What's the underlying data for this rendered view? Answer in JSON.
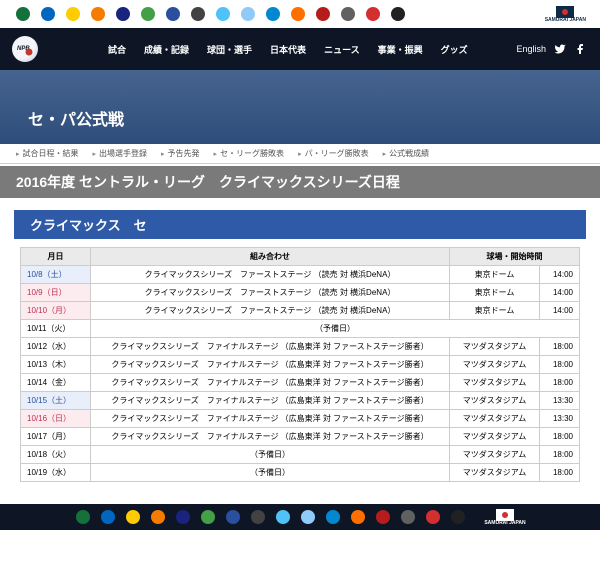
{
  "header": {
    "english_label": "English",
    "nav": [
      "試合",
      "成績・記録",
      "球団・選手",
      "日本代表",
      "ニュース",
      "事業・振興",
      "グッズ"
    ]
  },
  "team_logos": [
    {
      "bg": "#14713a",
      "name": "team-1"
    },
    {
      "bg": "#0066bf",
      "name": "team-2"
    },
    {
      "bg": "#fecc00",
      "name": "team-3"
    },
    {
      "bg": "#f57c00",
      "name": "team-4"
    },
    {
      "bg": "#1a237e",
      "name": "team-5"
    },
    {
      "bg": "#43a047",
      "name": "team-6"
    },
    {
      "bg": "#2a4f9e",
      "name": "team-7"
    },
    {
      "bg": "#424242",
      "name": "team-8"
    },
    {
      "bg": "#4fc3f7",
      "name": "team-9"
    },
    {
      "bg": "#90caf9",
      "name": "team-10"
    },
    {
      "bg": "#0288d1",
      "name": "team-11"
    },
    {
      "bg": "#ff6f00",
      "name": "team-12"
    },
    {
      "bg": "#b71c1c",
      "name": "team-13"
    },
    {
      "bg": "#616161",
      "name": "team-14"
    },
    {
      "bg": "#d32f2f",
      "name": "team-15"
    },
    {
      "bg": "#212121",
      "name": "team-16"
    }
  ],
  "samurai_label": "SAMURAI\nJAPAN",
  "hero_title": "セ・パ公式戦",
  "sub_nav": [
    "試合日程・結果",
    "出場選手登録",
    "予告先発",
    "セ・リーグ勝敗表",
    "パ・リーグ勝敗表",
    "公式戦成績"
  ],
  "title_bar": "2016年度 セントラル・リーグ　クライマックスシリーズ日程",
  "section_bar": "クライマックス　セ",
  "table": {
    "headers": {
      "date": "月日",
      "match": "組み合わせ",
      "venue_time": "球場・開始時間"
    },
    "rows": [
      {
        "date": "10/8（土）",
        "dayClass": "sat",
        "match": "クライマックスシリーズ　ファーストステージ （読売 対 横浜DeNA）",
        "venue": "東京ドーム",
        "time": "14:00"
      },
      {
        "date": "10/9（日）",
        "dayClass": "sun",
        "match": "クライマックスシリーズ　ファーストステージ （読売 対 横浜DeNA）",
        "venue": "東京ドーム",
        "time": "14:00"
      },
      {
        "date": "10/10（月）",
        "dayClass": "sun",
        "match": "クライマックスシリーズ　ファーストステージ （読売 対 横浜DeNA）",
        "venue": "東京ドーム",
        "time": "14:00"
      },
      {
        "date": "10/11（火）",
        "dayClass": "",
        "match": "（予備日）",
        "venue": "",
        "time": ""
      },
      {
        "date": "10/12（水）",
        "dayClass": "",
        "match": "クライマックスシリーズ　ファイナルステージ （広島東洋 対 ファーストステージ勝者）",
        "venue": "マツダスタジアム",
        "time": "18:00"
      },
      {
        "date": "10/13（木）",
        "dayClass": "",
        "match": "クライマックスシリーズ　ファイナルステージ （広島東洋 対 ファーストステージ勝者）",
        "venue": "マツダスタジアム",
        "time": "18:00"
      },
      {
        "date": "10/14（金）",
        "dayClass": "",
        "match": "クライマックスシリーズ　ファイナルステージ （広島東洋 対 ファーストステージ勝者）",
        "venue": "マツダスタジアム",
        "time": "18:00"
      },
      {
        "date": "10/15（土）",
        "dayClass": "sat",
        "match": "クライマックスシリーズ　ファイナルステージ （広島東洋 対 ファーストステージ勝者）",
        "venue": "マツダスタジアム",
        "time": "13:30"
      },
      {
        "date": "10/16（日）",
        "dayClass": "sun",
        "match": "クライマックスシリーズ　ファイナルステージ （広島東洋 対 ファーストステージ勝者）",
        "venue": "マツダスタジアム",
        "time": "13:30"
      },
      {
        "date": "10/17（月）",
        "dayClass": "",
        "match": "クライマックスシリーズ　ファイナルステージ （広島東洋 対 ファーストステージ勝者）",
        "venue": "マツダスタジアム",
        "time": "18:00"
      },
      {
        "date": "10/18（火）",
        "dayClass": "",
        "match": "（予備日）",
        "venue": "マツダスタジアム",
        "time": "18:00"
      },
      {
        "date": "10/19（水）",
        "dayClass": "",
        "match": "（予備日）",
        "venue": "マツダスタジアム",
        "time": "18:00"
      }
    ]
  }
}
